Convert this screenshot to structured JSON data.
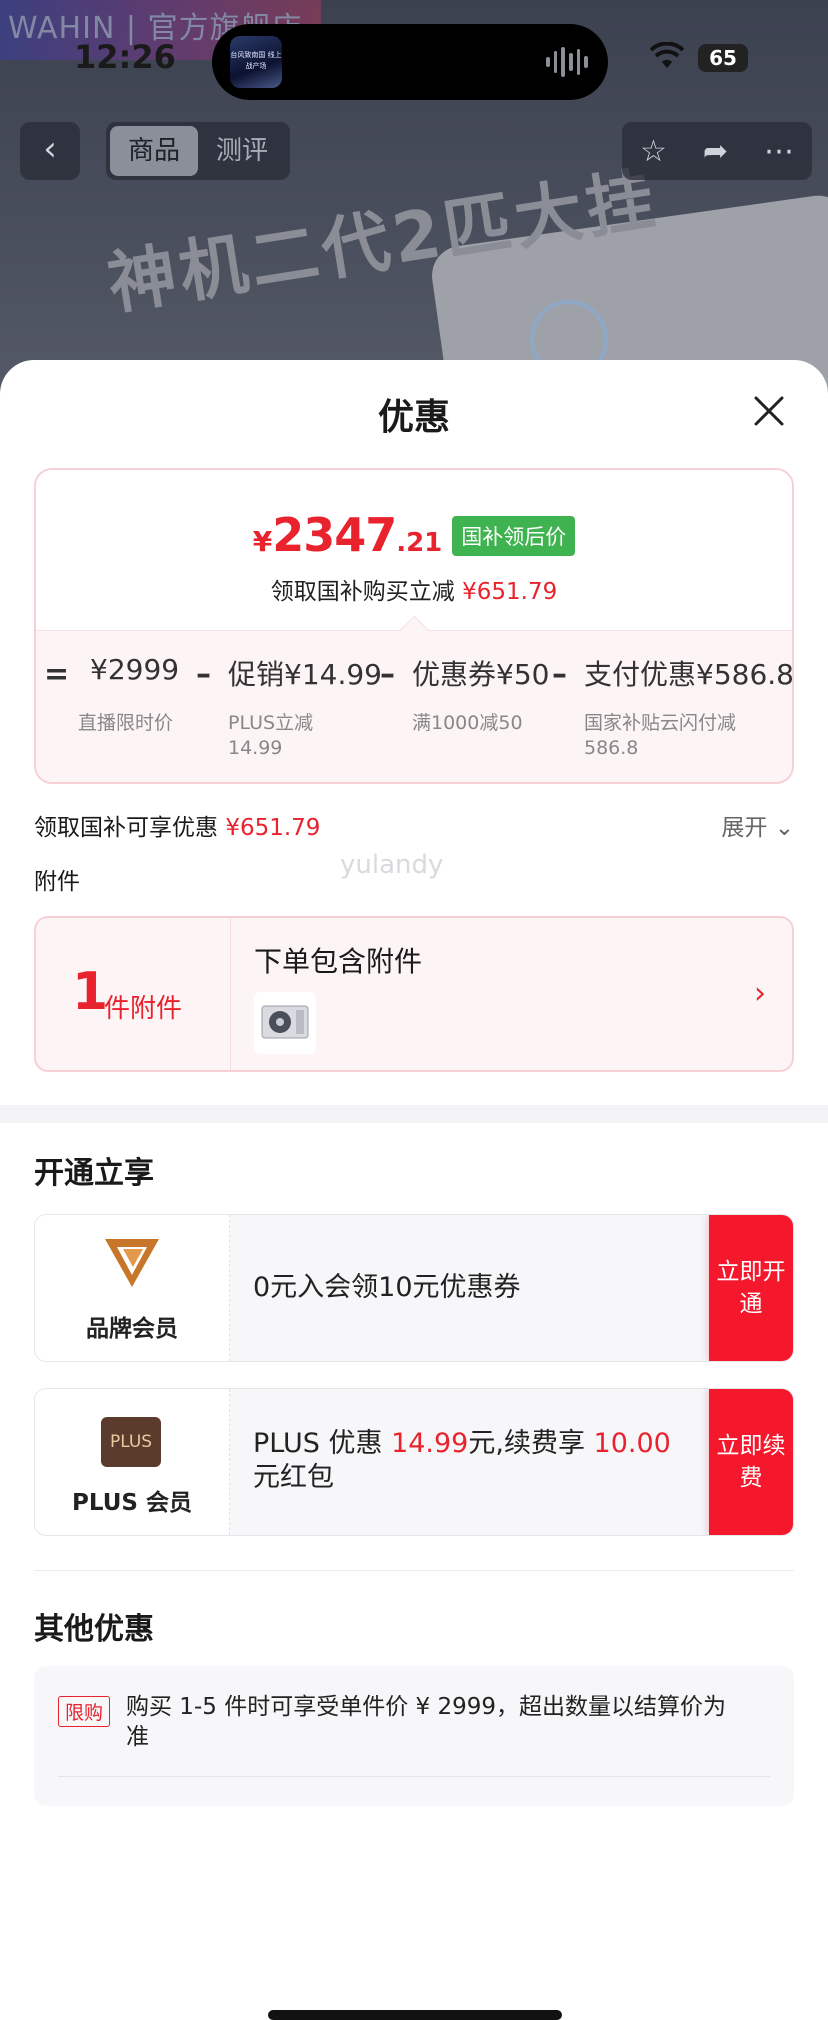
{
  "backdrop": {
    "shop_name": "WAHIN | 官方旗舰店",
    "status_time": "12:26",
    "battery": "65",
    "island_art_text": "台风致南国 线上战产场",
    "tabs": [
      "商品",
      "测评"
    ],
    "hero_text": "神机二代2匹大挂"
  },
  "sheet": {
    "title": "优惠"
  },
  "price": {
    "currency": "¥",
    "integer": "2347",
    "decimal": ".21",
    "badge": "国补领后价",
    "sub_prefix": "领取国补购买立减",
    "sub_amount": "¥651.79",
    "ops": [
      "=",
      "–",
      "–",
      "–"
    ],
    "items": [
      {
        "value": "¥2999",
        "note": "直播限时价"
      },
      {
        "value": "促销¥14.99",
        "note": "PLUS立减 14.99"
      },
      {
        "value": "优惠券¥50",
        "note": "满1000减50"
      },
      {
        "value": "支付优惠¥586.8",
        "note": "国家补贴云闪付减 586.8"
      }
    ]
  },
  "coupon_row": {
    "label": "领取国补可享优惠",
    "amount": "¥651.79",
    "expand": "展开"
  },
  "accessory": {
    "section_label": "附件",
    "watermark": "yulandy",
    "count": "1",
    "unit": "件附件",
    "title": "下单包含附件"
  },
  "membership": {
    "section_title": "开通立享",
    "brand": {
      "name": "品牌会员",
      "text": "0元入会领10元优惠券",
      "button": "立即开通"
    },
    "plus": {
      "logo": "PLUS",
      "name": "PLUS 会员",
      "text_1": "PLUS 优惠",
      "amount_1": "14.99",
      "text_2": "元,续费享",
      "amount_2": "10.00",
      "text_3": "元红包",
      "button": "立即续费"
    }
  },
  "other": {
    "section_title": "其他优惠",
    "limit_badge": "限购",
    "limit_text": "购买 1-5 件时可享受单件价 ¥ 2999，超出数量以结算价为准"
  },
  "colors": {
    "accent_red": "#e8232e",
    "button_red": "#f5182d",
    "badge_green": "#3fb34f"
  }
}
